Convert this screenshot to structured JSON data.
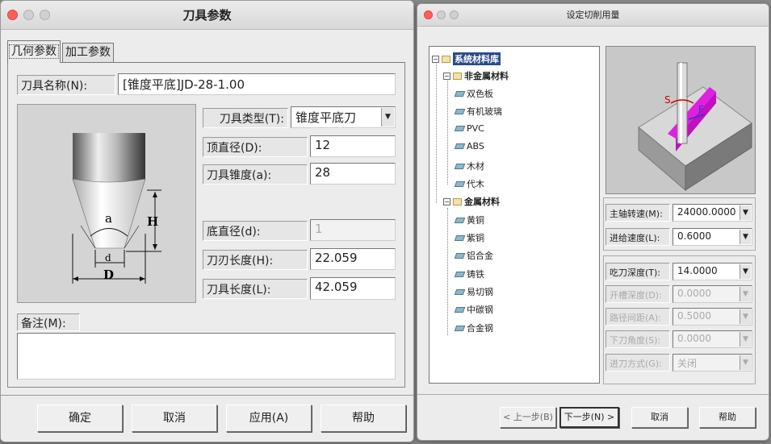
{
  "tool_dialog": {
    "title": "刀具参数",
    "tabs": [
      "几何参数",
      "加工参数"
    ],
    "name_label": "刀具名称(N):",
    "name_value": "[锥度平底]JD-28-1.00",
    "type_label": "刀具类型(T):",
    "type_value": "锥度平底刀",
    "top_dia_label": "顶直径(D):",
    "top_dia_value": "12",
    "taper_label": "刀具锥度(a):",
    "taper_value": "28",
    "bottom_dia_label": "底直径(d):",
    "bottom_dia_value": "1",
    "blade_len_label": "刀刃长度(H):",
    "blade_len_value": "22.059",
    "tool_len_label": "刀具长度(L):",
    "tool_len_value": "42.059",
    "note_label": "备注(M):",
    "diagram": {
      "a": "a",
      "H": "H",
      "d": "d",
      "D": "D"
    },
    "buttons": {
      "ok": "确定",
      "cancel": "取消",
      "apply": "应用(A)",
      "help": "帮助"
    }
  },
  "cut_dialog": {
    "title": "设定切削用量",
    "tree": {
      "root": "系统材料库",
      "nonmetal": "非金属材料",
      "nonmetal_items": [
        "双色板",
        "有机玻璃",
        "PVC",
        "ABS",
        "木材",
        "代木"
      ],
      "metal": "金属材料",
      "metal_items": [
        "黄铜",
        "紫铜",
        "铝合金",
        "铸铁",
        "易切钢",
        "中碳钢",
        "合金钢"
      ]
    },
    "preview": {
      "s_label": "S",
      "f_label": "F"
    },
    "spindle_label": "主轴转速(M):",
    "spindle_value": "24000.0000",
    "feed_label": "进给速度(L):",
    "feed_value": "0.6000",
    "depth_label": "吃刀深度(T):",
    "depth_value": "14.0000",
    "slot_label": "开槽深度(D):",
    "slot_value": "0.0000",
    "stepover_label": "路径间距(A):",
    "stepover_value": "0.5000",
    "angle_label": "下刀角度(S):",
    "angle_value": "0.0000",
    "entry_label": "进刀方式(G):",
    "entry_value": "关闭",
    "buttons": {
      "prev": "< 上一步(B)",
      "next": "下一步(N) >",
      "cancel": "取消",
      "help": "帮助"
    }
  }
}
